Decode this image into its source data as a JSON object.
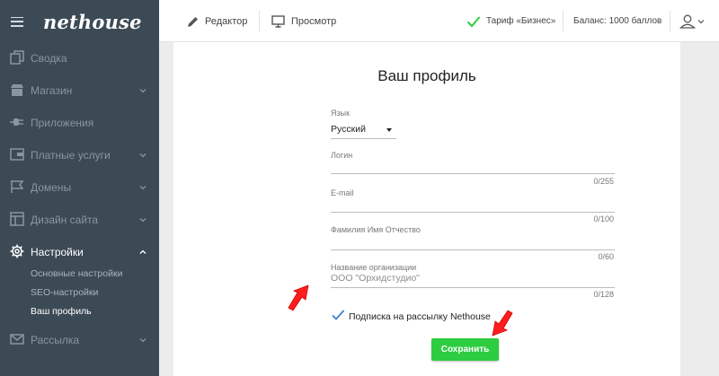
{
  "brand": {
    "logo_text": "nethouse"
  },
  "sidebar": {
    "items": [
      {
        "label": "Сводка",
        "icon": "copy-icon",
        "chevron": ""
      },
      {
        "label": "Магазин",
        "icon": "store-icon",
        "chevron": "down"
      },
      {
        "label": "Приложения",
        "icon": "plug-icon",
        "chevron": ""
      },
      {
        "label": "Платные услуги",
        "icon": "wallet-icon",
        "chevron": "down"
      },
      {
        "label": "Домены",
        "icon": "flag-icon",
        "chevron": "down"
      },
      {
        "label": "Дизайн сайта",
        "icon": "layout-icon",
        "chevron": "down"
      },
      {
        "label": "Настройки",
        "icon": "gear-icon",
        "chevron": "up",
        "active": true
      },
      {
        "label": "Рассылка",
        "icon": "mail-icon",
        "chevron": "down"
      }
    ],
    "subitems": [
      {
        "label": "Основные настройки"
      },
      {
        "label": "SEO-настройки"
      },
      {
        "label": "Ваш профиль",
        "active": true
      }
    ]
  },
  "topbar": {
    "editor_label": "Редактор",
    "preview_label": "Просмотр",
    "tariff_label": "Тариф «Бизнес»",
    "balance_label": "Баланс: 1000 баллов"
  },
  "page": {
    "title": "Ваш профиль",
    "language": {
      "label": "Язык",
      "value": "Русский"
    },
    "fields": [
      {
        "label": "Логин",
        "value": "",
        "counter": "0/255"
      },
      {
        "label": "E-mail",
        "value": "",
        "counter": "0/100"
      },
      {
        "label": "Фамилия Имя Отчество",
        "value": "",
        "counter": "0/60"
      },
      {
        "label": "Название организации",
        "placeholder": "ООО \"Орхидстудио\"",
        "counter": "0/128"
      }
    ],
    "subscription": {
      "label": "Подписка на рассылку Nethouse",
      "checked": true
    },
    "save_label": "Сохранить"
  },
  "colors": {
    "sidebar_bg": "#3c4a55",
    "accent_green": "#2ecc40",
    "arrow_red": "#ff1e1e",
    "check_blue": "#3b7fd6"
  }
}
